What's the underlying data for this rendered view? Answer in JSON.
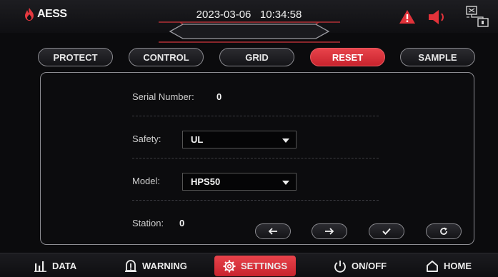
{
  "header": {
    "brand": "AESS",
    "date": "2023-03-06",
    "time": "10:34:58",
    "icons": [
      "alarm-icon",
      "speaker-icon",
      "network-icon"
    ]
  },
  "tabs": [
    {
      "label": "PROTECT",
      "active": false
    },
    {
      "label": "CONTROL",
      "active": false
    },
    {
      "label": "GRID",
      "active": false
    },
    {
      "label": "RESET",
      "active": true
    },
    {
      "label": "SAMPLE",
      "active": false
    }
  ],
  "form": {
    "serial": {
      "label": "Serial Number:",
      "value": "0"
    },
    "safety": {
      "label": "Safety:",
      "value": "UL"
    },
    "model": {
      "label": "Model:",
      "value": "HPS50"
    },
    "station": {
      "label": "Station:",
      "value": "0"
    }
  },
  "actions": [
    "arrow-left-icon",
    "arrow-right-icon",
    "checkmark-icon",
    "refresh-icon"
  ],
  "nav": [
    {
      "label": "DATA",
      "icon": "bar-chart-icon",
      "active": false
    },
    {
      "label": "WARNING",
      "icon": "warning-icon",
      "active": false
    },
    {
      "label": "SETTINGS",
      "icon": "gear-icon",
      "active": true
    },
    {
      "label": "ON/OFF",
      "icon": "power-icon",
      "active": false
    },
    {
      "label": "HOME",
      "icon": "home-icon",
      "active": false
    }
  ],
  "colors": {
    "accent": "#d8323b",
    "background": "#0b0b0d",
    "border": "#8d8d92"
  }
}
